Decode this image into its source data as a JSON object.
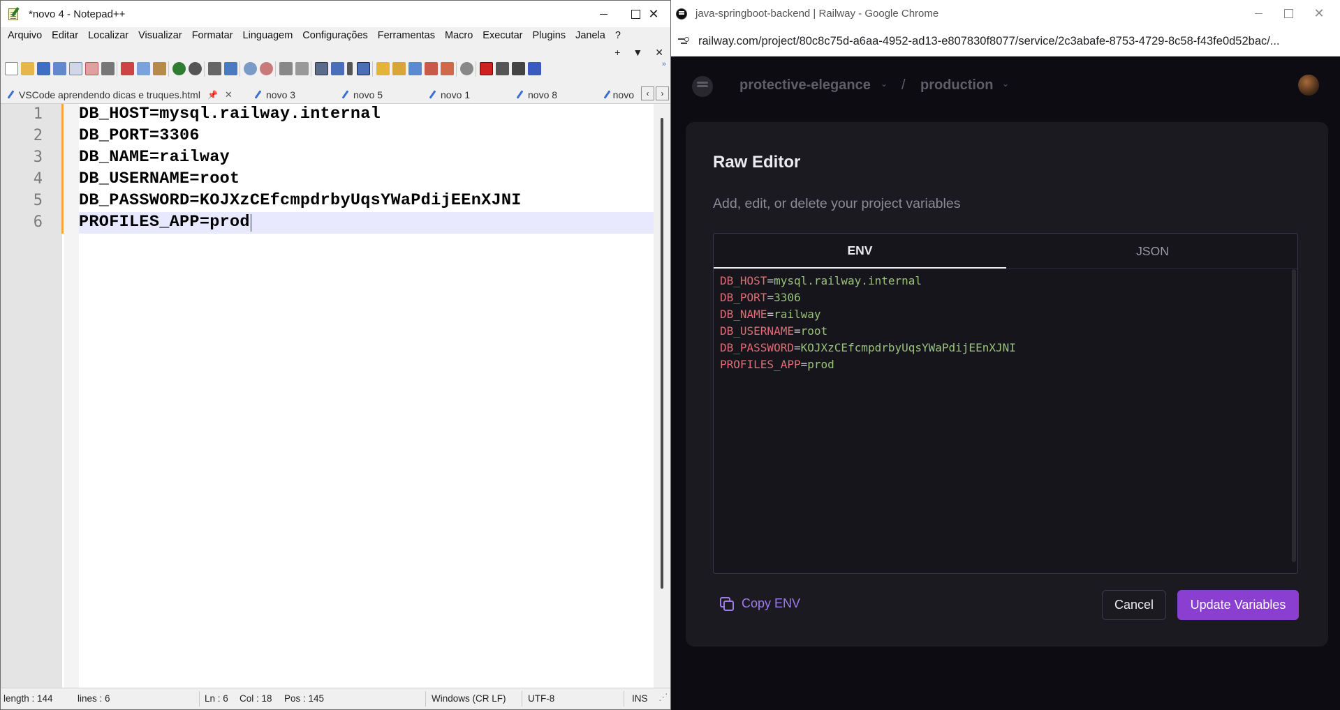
{
  "notepad": {
    "title": "*novo 4 - Notepad++",
    "menu": [
      "Arquivo",
      "Editar",
      "Localizar",
      "Visualizar",
      "Formatar",
      "Linguagem",
      "Configurações",
      "Ferramentas",
      "Macro",
      "Executar",
      "Plugins",
      "Janela",
      "?"
    ],
    "toolbar_extra": [
      "+",
      "▼",
      "✕"
    ],
    "tabs": [
      {
        "label": "VSCode aprendendo dicas e truques.html",
        "active": false
      },
      {
        "label": "novo 3",
        "active": false
      },
      {
        "label": "novo 5",
        "active": false
      },
      {
        "label": "novo 1",
        "active": false
      },
      {
        "label": "novo 8",
        "active": false
      },
      {
        "label": "novo",
        "active": false
      }
    ],
    "lines": [
      {
        "num": "1",
        "text": "DB_HOST=mysql.railway.internal"
      },
      {
        "num": "2",
        "text": "DB_PORT=3306"
      },
      {
        "num": "3",
        "text": "DB_NAME=railway"
      },
      {
        "num": "4",
        "text": "DB_USERNAME=root"
      },
      {
        "num": "5",
        "text": "DB_PASSWORD=KOJXzCEfcmpdrbyUqsYWaPdijEEnXJNI"
      },
      {
        "num": "6",
        "text": "PROFILES_APP=prod"
      }
    ],
    "status": {
      "length": "length : 144",
      "lines": "lines : 6",
      "ln": "Ln : 6",
      "col": "Col : 18",
      "pos": "Pos : 145",
      "eol": "Windows (CR LF)",
      "encoding": "UTF-8",
      "mode": "INS"
    }
  },
  "chrome": {
    "title": "java-springboot-backend | Railway - Google Chrome",
    "url": "railway.com/project/80c8c75d-a6aa-4952-ad13-e807830f8077/service/2c3abafe-8753-4729-8c58-f43fe0d52bac/...",
    "header": {
      "project": "protective-elegance",
      "separator": "/",
      "environment": "production"
    },
    "modal": {
      "title": "Raw Editor",
      "description": "Add, edit, or delete your project variables",
      "tabs": [
        "ENV",
        "JSON"
      ],
      "env": [
        {
          "key": "DB_HOST",
          "value": "mysql.railway.internal"
        },
        {
          "key": "DB_PORT",
          "value": "3306"
        },
        {
          "key": "DB_NAME",
          "value": "railway"
        },
        {
          "key": "DB_USERNAME",
          "value": "root"
        },
        {
          "key": "DB_PASSWORD",
          "value": "KOJXzCEfcmpdrbyUqsYWaPdijEEnXJNI"
        },
        {
          "key": "PROFILES_APP",
          "value": "prod"
        }
      ],
      "copy_label": "Copy ENV",
      "cancel_label": "Cancel",
      "update_label": "Update Variables"
    }
  },
  "colors": {
    "npp_changebar": "#f6a53b",
    "env_key": "#e06c75",
    "env_value": "#98c379",
    "railway_accent": "#8a3fd1"
  }
}
